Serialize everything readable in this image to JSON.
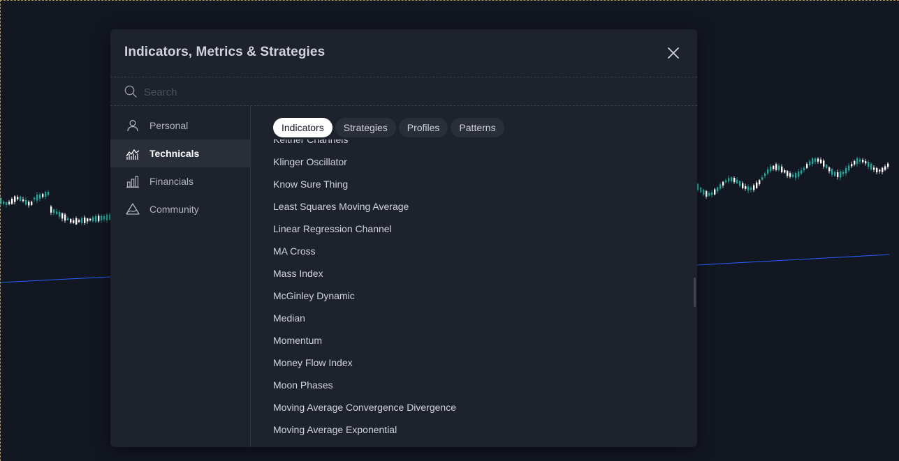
{
  "dialog": {
    "title": "Indicators, Metrics & Strategies",
    "close_icon": "close-icon"
  },
  "search": {
    "placeholder": "Search",
    "value": ""
  },
  "sidebar": {
    "items": [
      {
        "label": "Personal",
        "icon": "user-icon",
        "active": false
      },
      {
        "label": "Technicals",
        "icon": "chart-area-icon",
        "active": true
      },
      {
        "label": "Financials",
        "icon": "bar-chart-icon",
        "active": false
      },
      {
        "label": "Community",
        "icon": "community-icon",
        "active": false
      }
    ]
  },
  "tabs": [
    {
      "label": "Indicators",
      "active": true
    },
    {
      "label": "Strategies",
      "active": false
    },
    {
      "label": "Profiles",
      "active": false
    },
    {
      "label": "Patterns",
      "active": false
    }
  ],
  "indicators": [
    "Keltner Channels",
    "Klinger Oscillator",
    "Know Sure Thing",
    "Least Squares Moving Average",
    "Linear Regression Channel",
    "MA Cross",
    "Mass Index",
    "McGinley Dynamic",
    "Median",
    "Momentum",
    "Money Flow Index",
    "Moon Phases",
    "Moving Average Convergence Divergence",
    "Moving Average Exponential"
  ],
  "colors": {
    "background": "#131722",
    "dialog": "#1e222d",
    "up_candle": "#26a69a",
    "line": "#2962ff"
  }
}
